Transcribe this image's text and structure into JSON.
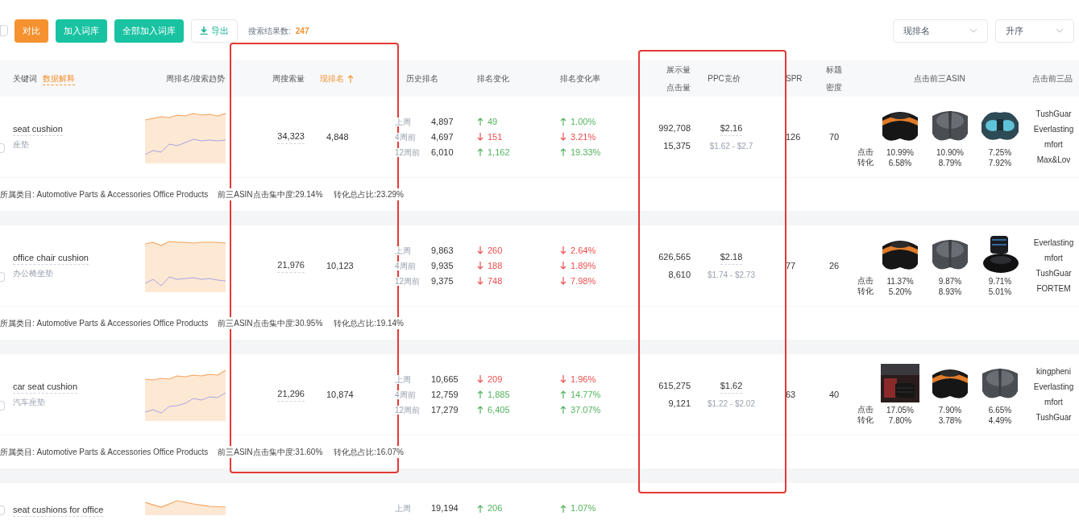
{
  "toolbar": {
    "buttons": [
      {
        "label": "对比",
        "kind": "primary"
      },
      {
        "label": "加入词库",
        "kind": "accent"
      },
      {
        "label": "全部加入词库",
        "kind": "accent"
      },
      {
        "label": "导出",
        "kind": "export"
      }
    ],
    "select_all_checked": false,
    "result_label": "搜索结果数:",
    "result_count": "247",
    "sort_field": "现排名",
    "sort_order": "升序"
  },
  "table": {
    "header": {
      "keyword": "关键词",
      "keyword_help": "数据解释",
      "trend": "周排名/搜索趋势",
      "search_volume": "周搜索量",
      "current_rank": "现排名",
      "current_rank_sorted": true,
      "history": "历史排名",
      "change": "排名变化",
      "rate": "排名变化率",
      "impressions": "展示量",
      "clicks": "点击量",
      "ppc": "PPC竞价",
      "spr": "SPR",
      "density": [
        "标题",
        "密度"
      ],
      "asins": "点击前三ASIN",
      "brands": "点击前三品"
    },
    "rows": [
      {
        "keyword": "seat cushion",
        "checked": false,
        "translation": "座垫",
        "search_volume": "34,323",
        "current_rank": "4,848",
        "history": [
          {
            "label": "上周",
            "rank": "4,897",
            "change": {
              "rising": true,
              "value": "49"
            },
            "rate": {
              "rising": true,
              "value": "1.00%"
            }
          },
          {
            "label": "4周前",
            "rank": "4,697",
            "change": {
              "rising": false,
              "value": "151"
            },
            "rate": {
              "rising": false,
              "value": "3.21%"
            }
          },
          {
            "label": "12周前",
            "rank": "6,010",
            "change": {
              "rising": true,
              "value": "1,162"
            },
            "rate": {
              "rising": true,
              "value": "19.33%"
            }
          }
        ],
        "impressions": "992,708",
        "clicks": "15,375",
        "ppc": "$2.16",
        "ppc_range": "$1.62 - $2.7",
        "spr": "126",
        "density": "70",
        "metric_labels": [
          "点击",
          "转化"
        ],
        "asins": [
          {
            "click": "10.99%",
            "conversion": "6.58%"
          },
          {
            "click": "10.90%",
            "conversion": "8.79%"
          },
          {
            "click": "7.25%",
            "conversion": "7.92%"
          }
        ],
        "brands": [
          "TushGuar",
          "Everlasting",
          "mfort",
          "Max&Lov"
        ],
        "category": {
          "category": "所属类目: Automotive Parts & Accessories Office Products",
          "concentration": "前三ASIN点击集中度:29.14%",
          "conversion_share": "转化总占比:23.29%"
        }
      },
      {
        "keyword": "office chair cushion",
        "checked": false,
        "translation": "办公椅坐垫",
        "search_volume": "21,976",
        "current_rank": "10,123",
        "history": [
          {
            "label": "上周",
            "rank": "9,863",
            "change": {
              "rising": false,
              "value": "260"
            },
            "rate": {
              "rising": false,
              "value": "2.64%"
            }
          },
          {
            "label": "4周前",
            "rank": "9,935",
            "change": {
              "rising": false,
              "value": "188"
            },
            "rate": {
              "rising": false,
              "value": "1.89%"
            }
          },
          {
            "label": "12周前",
            "rank": "9,375",
            "change": {
              "rising": false,
              "value": "748"
            },
            "rate": {
              "rising": false,
              "value": "7.98%"
            }
          }
        ],
        "impressions": "626,565",
        "clicks": "8,610",
        "ppc": "$2.18",
        "ppc_range": "$1.74 - $2.73",
        "spr": "77",
        "density": "26",
        "metric_labels": [
          "点击",
          "转化"
        ],
        "asins": [
          {
            "click": "11.37%",
            "conversion": "5.20%"
          },
          {
            "click": "9.87%",
            "conversion": "8.93%"
          },
          {
            "click": "9.71%",
            "conversion": "5.01%"
          }
        ],
        "brands": [
          "Everlasting",
          "mfort",
          "TushGuar",
          "FORTEM"
        ],
        "category": {
          "category": "所属类目: Automotive Parts & Accessories Office Products",
          "concentration": "前三ASIN点击集中度:30.95%",
          "conversion_share": "转化总占比:19.14%"
        }
      },
      {
        "keyword": "car seat cushion",
        "checked": false,
        "translation": "汽车座垫",
        "search_volume": "21,296",
        "current_rank": "10,874",
        "history": [
          {
            "label": "上周",
            "rank": "10,665",
            "change": {
              "rising": false,
              "value": "209"
            },
            "rate": {
              "rising": false,
              "value": "1.96%"
            }
          },
          {
            "label": "4周前",
            "rank": "12,759",
            "change": {
              "rising": true,
              "value": "1,885"
            },
            "rate": {
              "rising": true,
              "value": "14.77%"
            }
          },
          {
            "label": "12周前",
            "rank": "17,279",
            "change": {
              "rising": true,
              "value": "6,405"
            },
            "rate": {
              "rising": true,
              "value": "37.07%"
            }
          }
        ],
        "impressions": "615,275",
        "clicks": "9,121",
        "ppc": "$1.62",
        "ppc_range": "$1.22 - $2.02",
        "spr": "63",
        "density": "40",
        "metric_labels": [
          "点击",
          "转化"
        ],
        "asins": [
          {
            "click": "17.05%",
            "conversion": "7.80%"
          },
          {
            "click": "7.90%",
            "conversion": "3.78%"
          },
          {
            "click": "6.65%",
            "conversion": "4.49%"
          }
        ],
        "brands": [
          "kingpheni",
          "Everlasting",
          "mfort",
          "TushGuar"
        ],
        "category": {
          "category": "所属类目: Automotive Parts & Accessories Office Products",
          "concentration": "前三ASIN点击集中度:31.60%",
          "conversion_share": "转化总占比:16.07%"
        }
      },
      {
        "keyword": "seat cushions for office",
        "checked": false,
        "history": [
          {
            "label": "上周",
            "rank": "19,194",
            "change": {
              "rising": true,
              "value": "206"
            },
            "rate": {
              "rising": true,
              "value": "1.07%"
            }
          }
        ]
      }
    ]
  }
}
